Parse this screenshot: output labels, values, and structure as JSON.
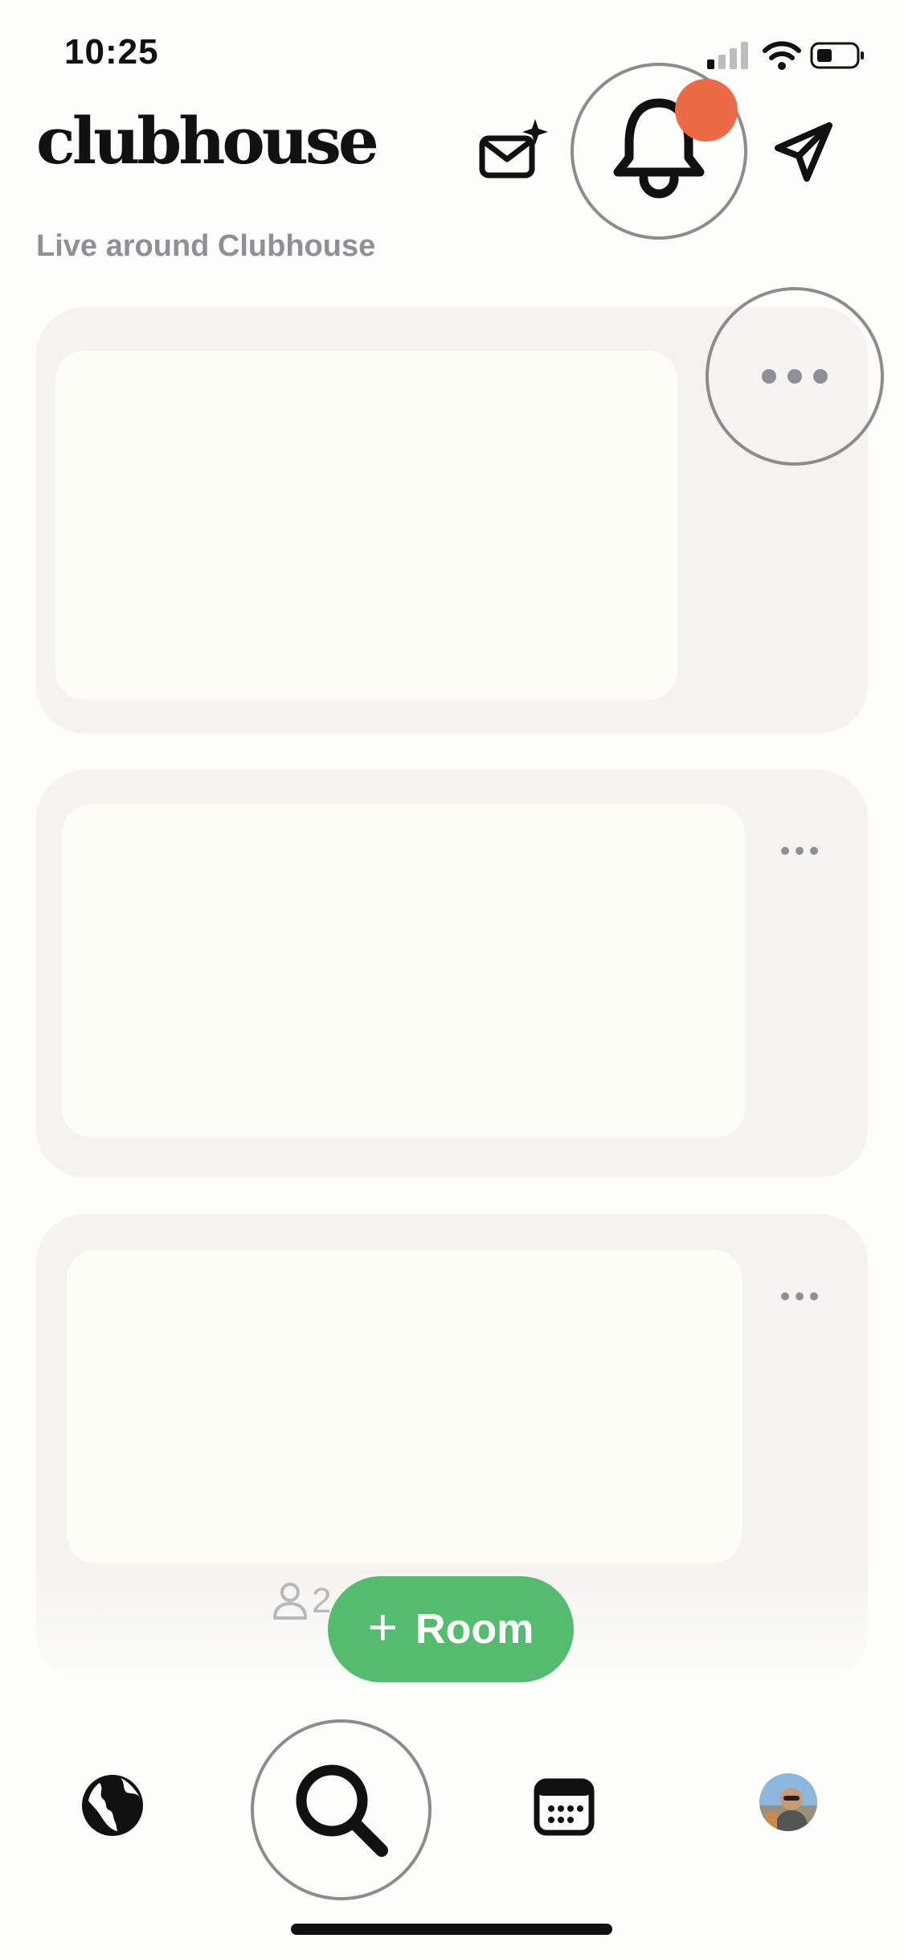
{
  "status_bar": {
    "time": "10:25"
  },
  "header": {
    "logo": "clubhouse",
    "subtitle": "Live around Clubhouse",
    "notification_dot_color": "#ec6a46"
  },
  "icons": {
    "invite": "mail-sparkle-icon",
    "notifications": "bell-icon",
    "messages": "paper-plane-icon",
    "more": "more-horizontal-icon",
    "explore": "globe-icon",
    "search": "search-icon",
    "events": "calendar-icon",
    "profile": "avatar"
  },
  "cards": [
    {
      "id": "card-1"
    },
    {
      "id": "card-2"
    },
    {
      "id": "card-3",
      "listener_count": "2"
    }
  ],
  "room_button": {
    "label": "Room",
    "color": "#55bb6e"
  }
}
